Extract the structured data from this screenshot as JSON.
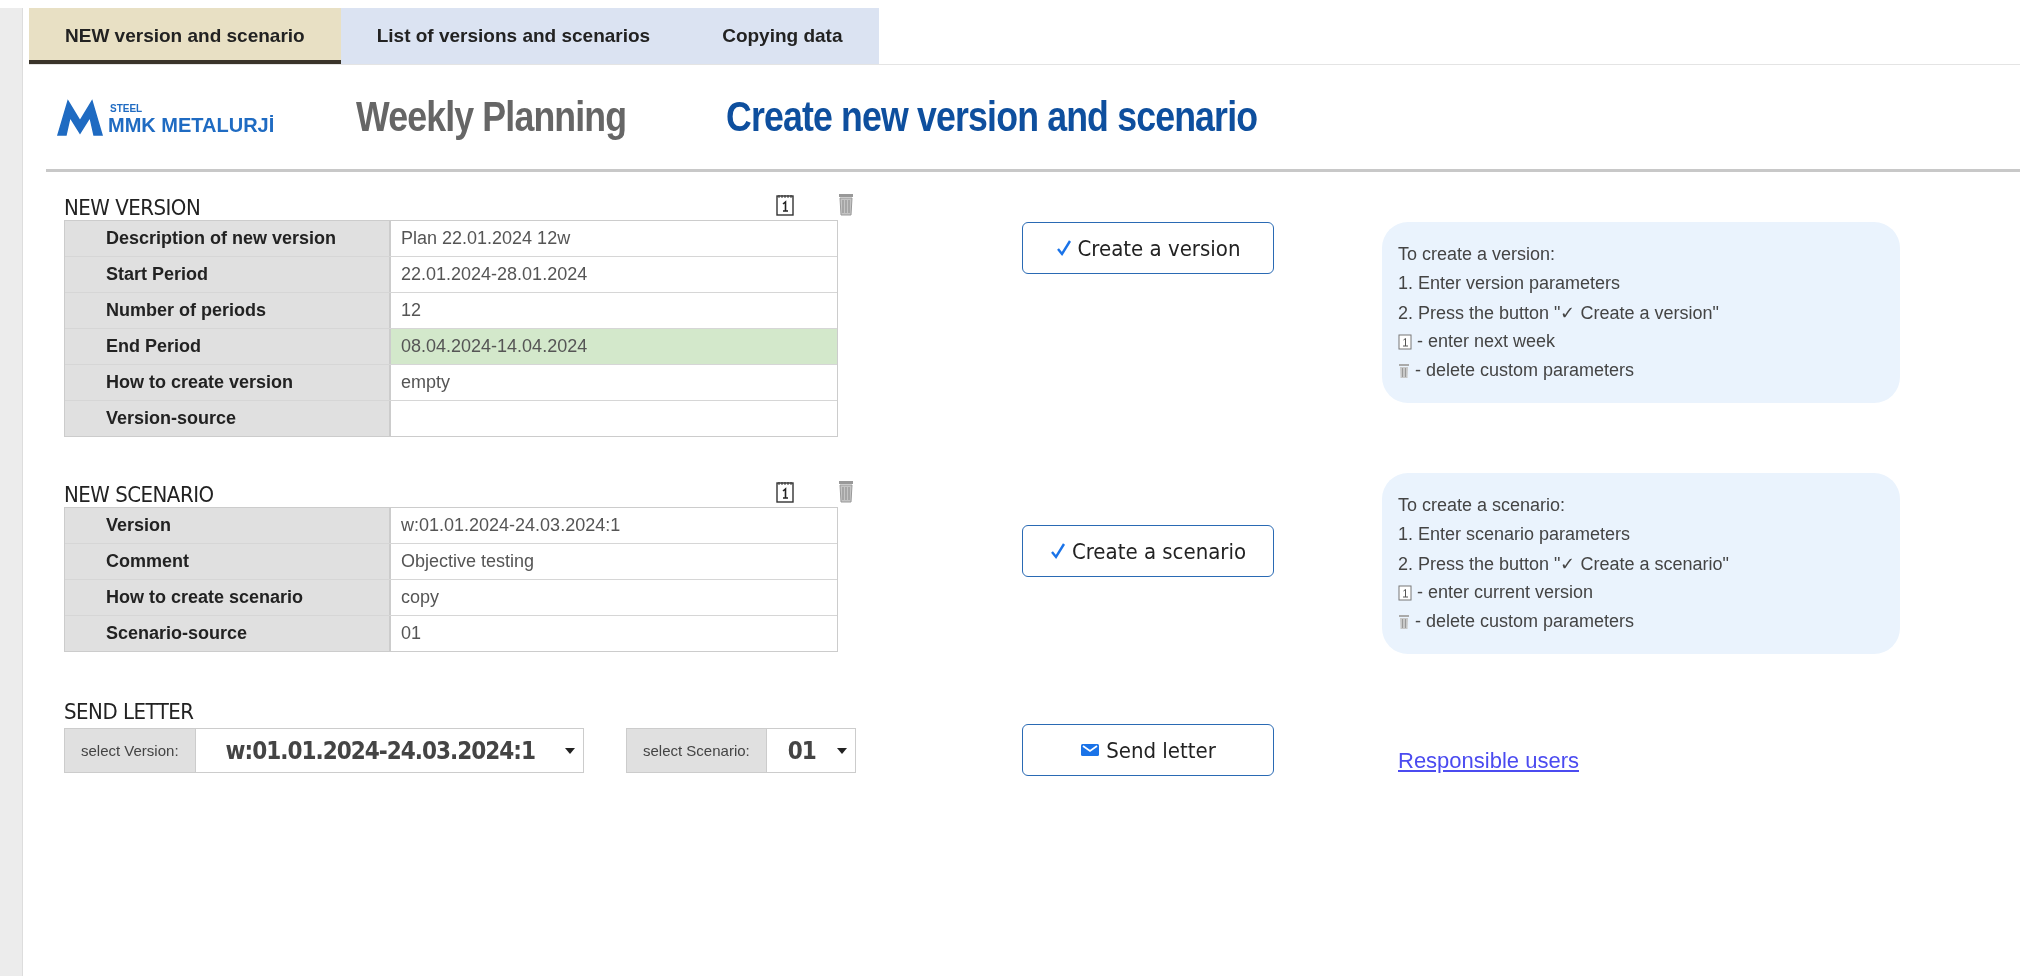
{
  "tabs": [
    {
      "label": "NEW version and scenario",
      "selected": true
    },
    {
      "label": "List of versions and scenarios",
      "selected": false
    },
    {
      "label": "Copying data",
      "selected": false
    }
  ],
  "header": {
    "logo_small": "STEEL",
    "logo_name": "MMK METALURJİ",
    "app_title": "Weekly Planning",
    "page_title": "Create new version and scenario"
  },
  "sections": [
    {
      "title": "NEW VERSION",
      "rows": [
        {
          "label": "Description of new version",
          "value": "Plan 22.01.2024 12w",
          "highlighted": false
        },
        {
          "label": "Start Period",
          "value": "22.01.2024-28.01.2024",
          "highlighted": false
        },
        {
          "label": "Number of periods",
          "value": "12",
          "highlighted": false
        },
        {
          "label": "End Period",
          "value": "08.04.2024-14.04.2024",
          "highlighted": true
        },
        {
          "label": "How to create version",
          "value": "empty",
          "highlighted": false
        },
        {
          "label": "Version-source",
          "highlighted": false
        }
      ],
      "button": "Create a version",
      "help": [
        {
          "kind": "text",
          "text": "To create a version:"
        },
        {
          "kind": "text",
          "text": "1. Enter version parameters"
        },
        {
          "kind": "text",
          "text": "2. Press the button \"✓ Create a version\""
        },
        {
          "kind": "calendar",
          "text": "- enter next week"
        },
        {
          "kind": "trash",
          "text": "- delete custom parameters"
        }
      ]
    },
    {
      "title": "NEW SCENARIO",
      "rows": [
        {
          "label": "Version",
          "value": "w:01.01.2024-24.03.2024:1",
          "highlighted": false
        },
        {
          "label": "Comment",
          "value": "Objective testing",
          "highlighted": false
        },
        {
          "label": "How to create scenario",
          "value": "copy",
          "highlighted": false
        },
        {
          "label": "Scenario-source",
          "value": "01",
          "highlighted": false
        }
      ],
      "button": "Create a scenario",
      "help": [
        {
          "kind": "text",
          "text": "To create a scenario:"
        },
        {
          "kind": "text",
          "text": "1. Enter scenario parameters"
        },
        {
          "kind": "text",
          "text": "2. Press the button \"✓ Create a scenario\""
        },
        {
          "kind": "calendar",
          "text": "- enter current version"
        },
        {
          "kind": "trash",
          "text": "- delete custom parameters"
        }
      ]
    }
  ],
  "send_letter": {
    "title": "SEND LETTER",
    "version_label": "select Version:",
    "version_value": "w:01.01.2024-24.03.2024:1",
    "scenario_label": "select Scenario:",
    "scenario_value": "01",
    "button": "Send letter",
    "link": "Responsible users"
  }
}
